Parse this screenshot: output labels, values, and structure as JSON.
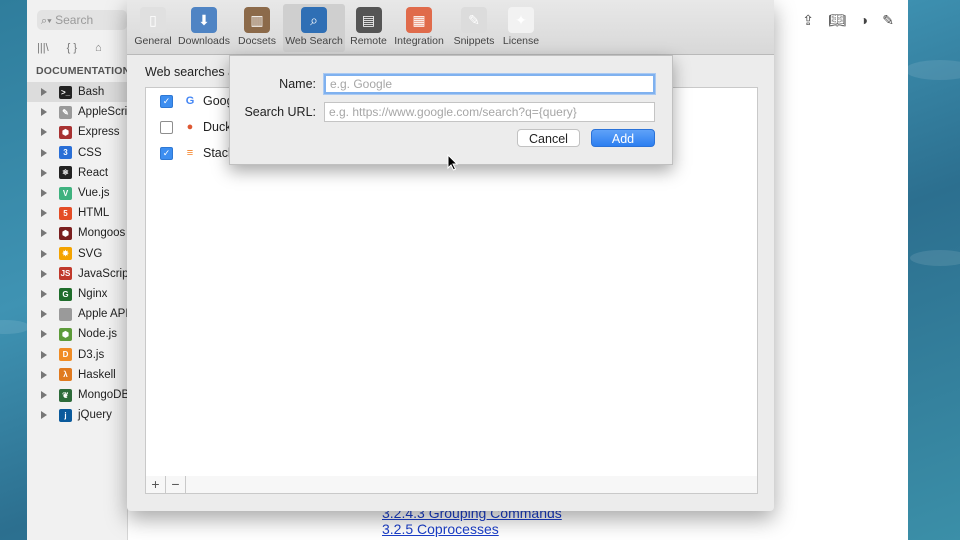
{
  "sidebar": {
    "search_placeholder": "Search",
    "section_heading": "DOCUMENTATION",
    "docsets": [
      {
        "label": "Bash",
        "icon": "terminal-icon",
        "color": "#222222",
        "glyph": ">_"
      },
      {
        "label": "AppleScri",
        "icon": "applescript-icon",
        "color": "#9a9a9a",
        "glyph": "✎"
      },
      {
        "label": "Express",
        "icon": "express-icon",
        "color": "#a83232",
        "glyph": "⬢"
      },
      {
        "label": "CSS",
        "icon": "css-icon",
        "color": "#2a6fd6",
        "glyph": "3"
      },
      {
        "label": "React",
        "icon": "react-icon",
        "color": "#222222",
        "glyph": "⚛"
      },
      {
        "label": "Vue.js",
        "icon": "vue-icon",
        "color": "#3fb27f",
        "glyph": "V"
      },
      {
        "label": "HTML",
        "icon": "html-icon",
        "color": "#e44d26",
        "glyph": "5"
      },
      {
        "label": "Mongoos",
        "icon": "mongoose-icon",
        "color": "#7a1f1f",
        "glyph": "⬢"
      },
      {
        "label": "SVG",
        "icon": "svg-icon",
        "color": "#f4a300",
        "glyph": "✸"
      },
      {
        "label": "JavaScrip",
        "icon": "javascript-icon",
        "color": "#c0392b",
        "glyph": "JS"
      },
      {
        "label": "Nginx",
        "icon": "nginx-icon",
        "color": "#1f6d2b",
        "glyph": "G"
      },
      {
        "label": "Apple API",
        "icon": "apple-icon",
        "color": "#9a9a9a",
        "glyph": ""
      },
      {
        "label": "Node.js",
        "icon": "nodejs-icon",
        "color": "#5d9b3a",
        "glyph": "⬢"
      },
      {
        "label": "D3.js",
        "icon": "d3-icon",
        "color": "#f08c25",
        "glyph": "D"
      },
      {
        "label": "Haskell",
        "icon": "haskell-icon",
        "color": "#e07a1f",
        "glyph": "λ"
      },
      {
        "label": "MongoDB",
        "icon": "mongodb-icon",
        "color": "#2d6b3a",
        "glyph": "❦"
      },
      {
        "label": "jQuery",
        "icon": "jquery-icon",
        "color": "#0a5a9c",
        "glyph": "j"
      }
    ]
  },
  "content": {
    "links": [
      "3.2.4.3 Grouping Commands",
      "3.2.5 Coprocesses"
    ]
  },
  "prefs": {
    "toolbar": [
      {
        "label": "General",
        "icon": "switch-icon",
        "active": false
      },
      {
        "label": "Downloads",
        "icon": "download-icon",
        "active": false
      },
      {
        "label": "Docsets",
        "icon": "books-icon",
        "active": false
      },
      {
        "label": "Web Search",
        "icon": "magnifier-icon",
        "active": true
      },
      {
        "label": "Remote",
        "icon": "remote-icon",
        "active": false
      },
      {
        "label": "Integration",
        "icon": "lego-icon",
        "active": false
      },
      {
        "label": "Snippets",
        "icon": "snippets-icon",
        "active": false
      },
      {
        "label": "License",
        "icon": "license-icon",
        "active": false
      }
    ],
    "section_title": "Web searches a",
    "searches": [
      {
        "name": "Goog",
        "checked": true,
        "icon": "google-icon"
      },
      {
        "name": "Duck",
        "checked": false,
        "icon": "duckduckgo-icon"
      },
      {
        "name": "Stack",
        "checked": true,
        "icon": "stackoverflow-icon"
      }
    ],
    "footer": {
      "add": "+",
      "remove": "−"
    }
  },
  "sheet": {
    "name_label": "Name:",
    "name_placeholder": "e.g. Google",
    "url_label": "Search URL:",
    "url_placeholder": "e.g. https://www.google.com/search?q={query}",
    "cancel_label": "Cancel",
    "add_label": "Add"
  }
}
